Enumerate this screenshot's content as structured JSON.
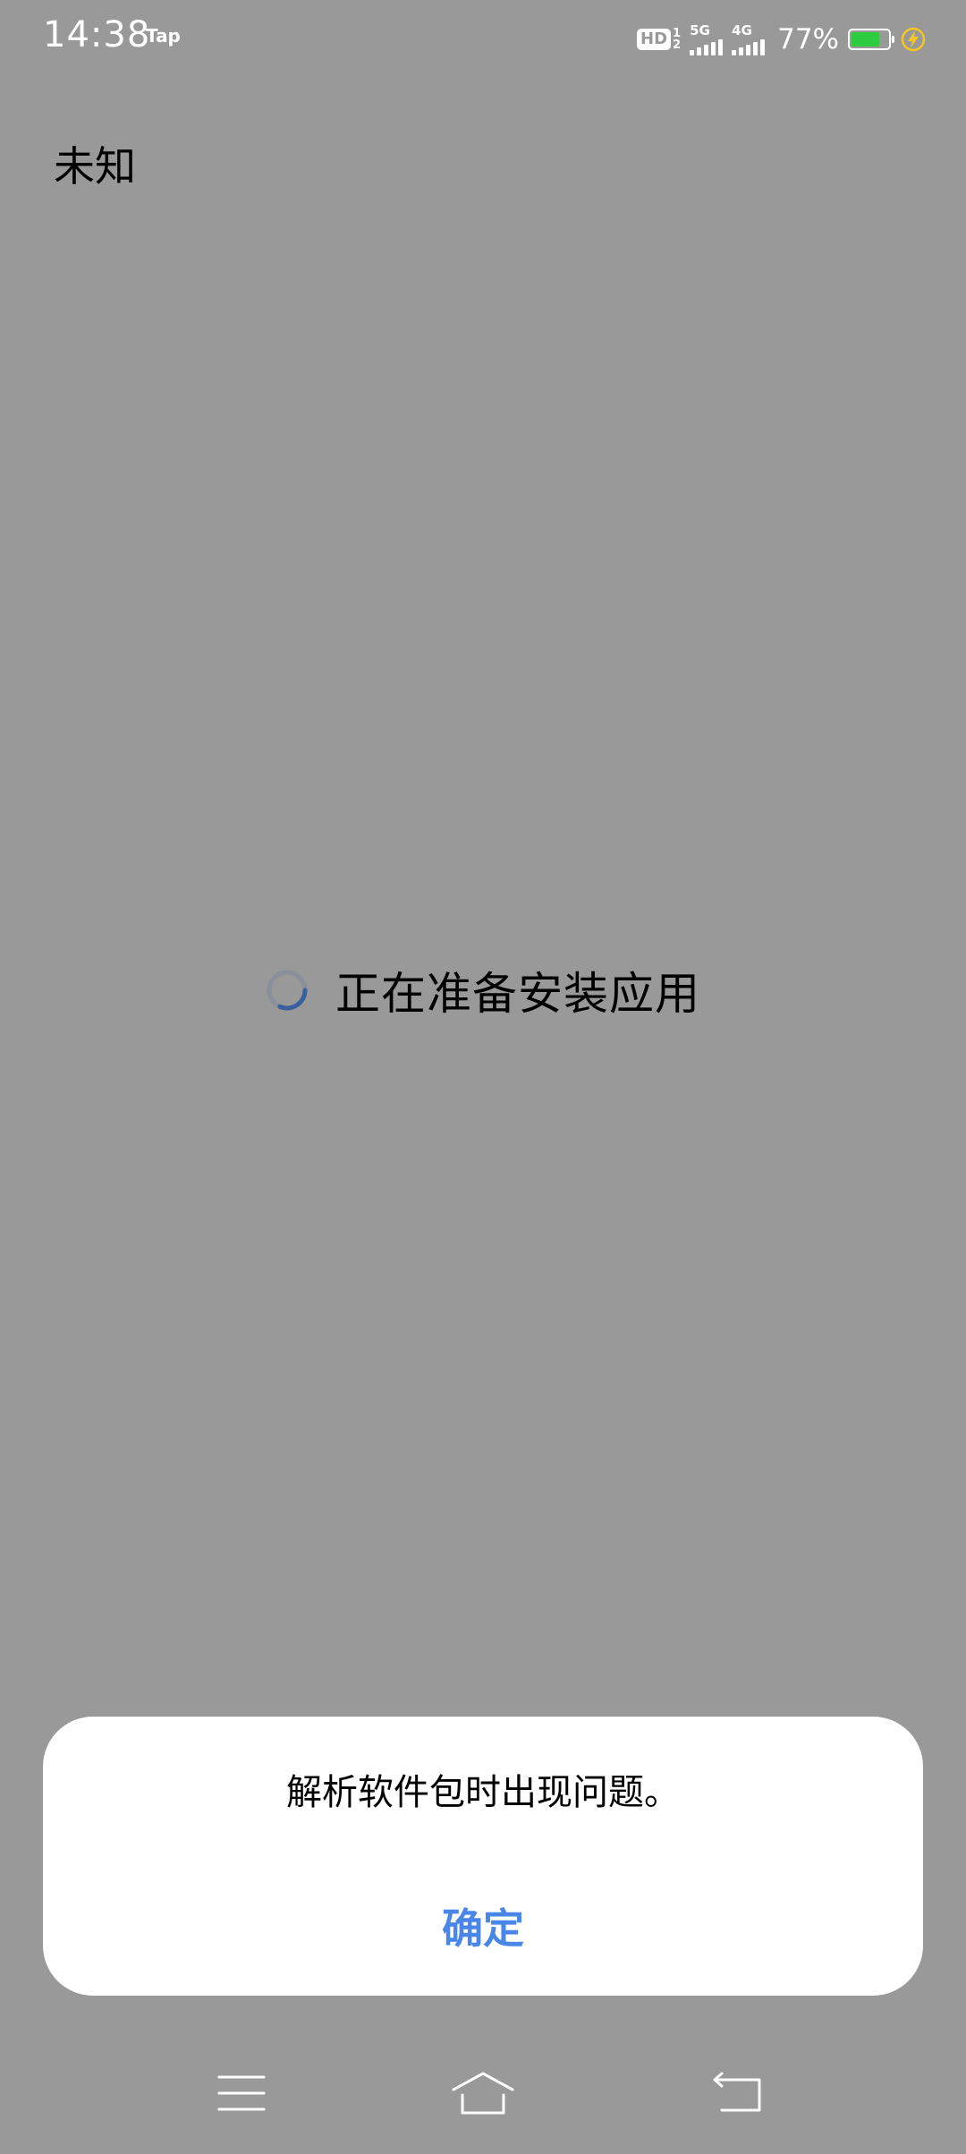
{
  "status_bar": {
    "time": "14:38",
    "app_indicator": "Tap",
    "hd_label": "HD",
    "sim_slots": [
      "1",
      "2"
    ],
    "network_1": "5G",
    "network_2": "4G",
    "battery_percent": "77%",
    "battery_level": 0.77,
    "battery_color": "#2ecc40",
    "charging_icon": "charging-bolt-icon"
  },
  "page": {
    "title": "未知",
    "progress_text": "正在准备安装应用",
    "spinner_color": "#3a5f9e"
  },
  "dialog": {
    "message": "解析软件包时出现问题。",
    "confirm_label": "确定",
    "accent_color": "#4a86e8"
  },
  "nav": {
    "menu_icon": "menu-icon",
    "home_icon": "home-icon",
    "back_icon": "back-icon"
  }
}
